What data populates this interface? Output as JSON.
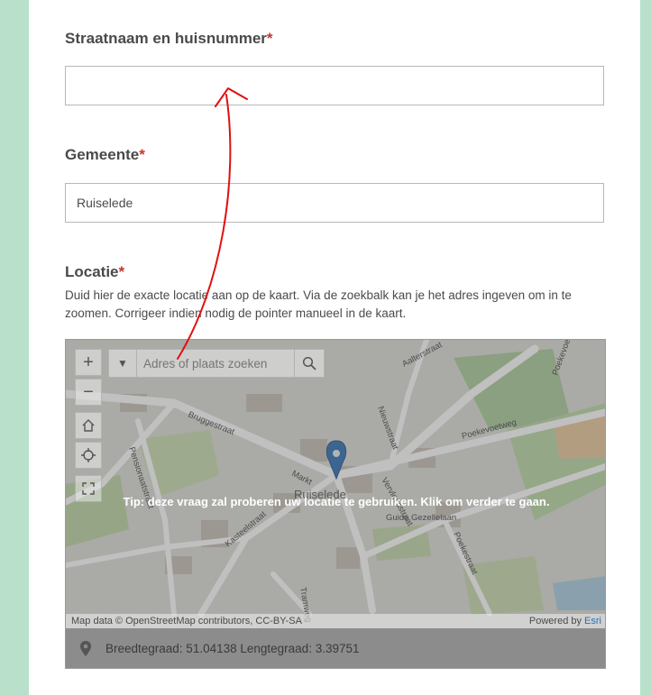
{
  "form": {
    "street": {
      "label": "Straatnaam en huisnummer",
      "required_mark": "*",
      "value": ""
    },
    "municipality": {
      "label": "Gemeente",
      "required_mark": "*",
      "value": "Ruiselede"
    },
    "location": {
      "label": "Locatie",
      "required_mark": "*",
      "help": "Duid hier de exacte locatie aan op de kaart. Via de zoekbalk kan je het adres ingeven om in te zoomen. Corrigeer indien nodig de pointer manueel in de kaart."
    }
  },
  "map": {
    "search_placeholder": "Adres of plaats zoeken",
    "tip": "Tip: deze vraag zal proberen uw locatie te gebruiken. Klik om verder te gaan.",
    "attribution": "Map data © OpenStreetMap contributors, CC-BY-SA",
    "powered_by": "Powered by",
    "powered_by_brand": "Esri",
    "town_label": "Ruiselede",
    "streets": [
      "Bruggestraat",
      "Aalterstraat",
      "Nieuwstraat",
      "Poekevoetweg",
      "Vervloesstraat",
      "Markt",
      "Pensionaatstraat",
      "Guido Gezellelaan",
      "Kasteelstraat",
      "Poekestraat",
      "Tramweg",
      "Poekevoetweg"
    ],
    "coordinates": "Breedtegraad: 51.04138  Lengtegraad: 3.39751",
    "colors": {
      "marker": "#2b6cb0",
      "annotation": "#e01010"
    }
  }
}
